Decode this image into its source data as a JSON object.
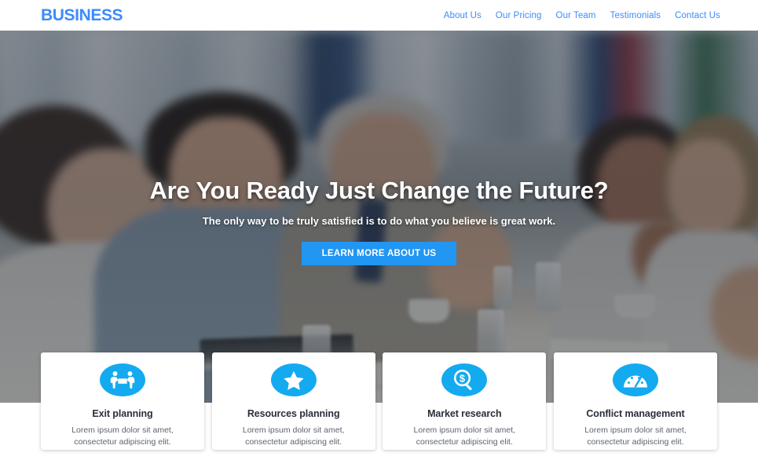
{
  "header": {
    "logo": "BUSINESS",
    "nav": [
      {
        "label": "About Us"
      },
      {
        "label": "Our Pricing"
      },
      {
        "label": "Our Team"
      },
      {
        "label": "Testimonials"
      },
      {
        "label": "Contact Us"
      }
    ]
  },
  "hero": {
    "title": "Are You Ready Just Change the Future?",
    "subtitle": "The only way to be truly satisfied is to do what you believe is great work.",
    "cta_label": "LEARN MORE ABOUT US",
    "background_description": "business meeting around a conference table",
    "overlay_color": "#1c222c"
  },
  "cards": [
    {
      "icon": "people-carrying-box-icon",
      "title": "Exit planning",
      "text": "Lorem ipsum dolor sit amet, consectetur adipiscing elit."
    },
    {
      "icon": "star-icon",
      "title": "Resources planning",
      "text": "Lorem ipsum dolor sit amet, consectetur adipiscing elit."
    },
    {
      "icon": "magnifier-dollar-icon",
      "title": "Market research",
      "text": "Lorem ipsum dolor sit amet, consectetur adipiscing elit."
    },
    {
      "icon": "speedometer-icon",
      "title": "Conflict management",
      "text": "Lorem ipsum dolor sit amet, consectetur adipiscing elit."
    }
  ],
  "theme": {
    "brand_blue": "#3d8bfd",
    "button_blue": "#2196f3",
    "icon_blue": "#14aaf0",
    "text_dark": "#2b2f3a",
    "text_muted": "#5d6470"
  }
}
